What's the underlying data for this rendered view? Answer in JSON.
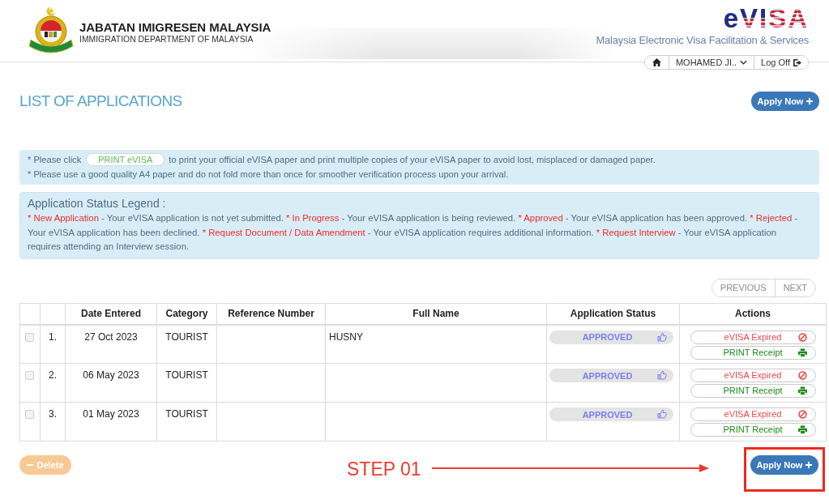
{
  "header": {
    "agency_name": "JABATAN IMIGRESEN MALAYSIA",
    "agency_subtitle": "IMMIGRATION DEPARTMENT OF MALAYSIA",
    "brand": "eVISA",
    "tagline": "Malaysia Electronic Visa Facilitation & Services",
    "nav": {
      "user": "MOHAMED JI..",
      "logout": "Log Off"
    }
  },
  "page": {
    "title": "LIST OF APPLICATIONS",
    "apply_button": "Apply Now"
  },
  "notice": {
    "lines": [
      {
        "text": "* Please click",
        "button": "PRINT eVISA",
        "after": "to print your official eVISA paper and print multiple copies of your eVISA paper to avoid lost, misplaced or damaged paper."
      },
      {
        "text": "* Please use a good quality A4 paper and do not fold more than once for smoother verification process upon your arrival."
      }
    ]
  },
  "legend": {
    "title": "Application Status Legend :",
    "items": [
      {
        "status": "* New Application",
        "description": "- Your eVISA application is not yet submitted."
      },
      {
        "status": "* In Progress",
        "description": "- Your eVISA application is being reviewed."
      },
      {
        "status": "* Approved",
        "description": "- Your eVISA application has been approved."
      },
      {
        "status": "* Rejected",
        "description": "- Your eVISA application has been declined."
      },
      {
        "status": "* Request Document / Data Amendment",
        "description": "- Your eVISA application requires additional information."
      },
      {
        "status": "* Request Interview",
        "description": "- Your eVISA application requires attending an Interview session."
      }
    ]
  },
  "pagination": {
    "previous": "PREVIOUS",
    "next": "NEXT"
  },
  "table": {
    "columns": [
      "Date Entered",
      "Category",
      "Reference Number",
      "Full Name",
      "Application Status",
      "Actions"
    ],
    "rows": [
      {
        "checked": false,
        "number": "1.",
        "date": "27 Oct 2023",
        "category": "TOURIST",
        "full_name": "HUSNY",
        "status": "APPROVED",
        "actions": [
          {
            "kind": "expired",
            "label": "eVISA Expired"
          },
          {
            "kind": "print",
            "label": "PRINT Receipt"
          }
        ]
      },
      {
        "checked": false,
        "number": "2.",
        "date": "06 May 2023",
        "category": "TOURIST",
        "status": "APPROVED",
        "actions": [
          {
            "kind": "expired",
            "label": "eVISA Expired"
          },
          {
            "kind": "print",
            "label": "PRINT Receipt"
          }
        ]
      },
      {
        "checked": false,
        "number": "3.",
        "date": "01 May 2023",
        "category": "TOURIST",
        "status": "APPROVED",
        "actions": [
          {
            "kind": "expired",
            "label": "eVISA Expired"
          },
          {
            "kind": "print",
            "label": "PRINT Receipt"
          }
        ]
      }
    ]
  },
  "footer": {
    "delete_button": {
      "label": "Delete",
      "disabled": true
    },
    "apply_button": "Apply Now"
  },
  "annotation": {
    "label": "STEP 01"
  }
}
